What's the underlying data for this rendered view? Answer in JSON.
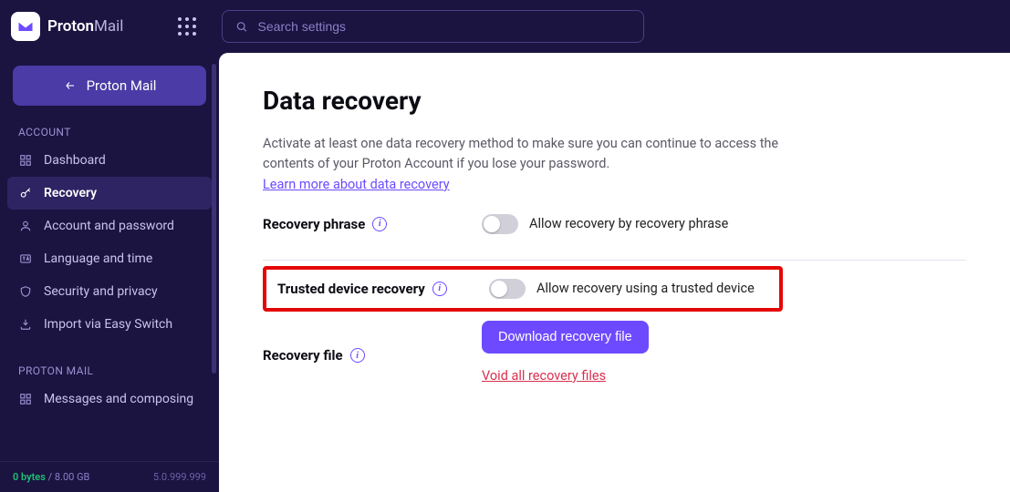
{
  "brand": {
    "name": "Proton",
    "suffix": "Mail"
  },
  "search": {
    "placeholder": "Search settings"
  },
  "back_button": {
    "label": "Proton Mail"
  },
  "sidebar": {
    "sections": [
      {
        "label": "ACCOUNT",
        "items": [
          {
            "label": "Dashboard"
          },
          {
            "label": "Recovery"
          },
          {
            "label": "Account and password"
          },
          {
            "label": "Language and time"
          },
          {
            "label": "Security and privacy"
          },
          {
            "label": "Import via Easy Switch"
          }
        ]
      },
      {
        "label": "PROTON MAIL",
        "items": [
          {
            "label": "Messages and composing"
          }
        ]
      }
    ]
  },
  "footer": {
    "used": "0 bytes",
    "sep": " / ",
    "total": "8.00 GB",
    "version": "5.0.999.999"
  },
  "page": {
    "title": "Data recovery",
    "description": "Activate at least one data recovery method to make sure you can continue to access the contents of your Proton Account if you lose your password.",
    "learn_more": "Learn more about data recovery",
    "rows": {
      "phrase": {
        "label": "Recovery phrase",
        "toggle_label": "Allow recovery by recovery phrase"
      },
      "trusted": {
        "label": "Trusted device recovery",
        "toggle_label": "Allow recovery using a trusted device"
      },
      "file": {
        "label": "Recovery file",
        "button": "Download recovery file",
        "void": "Void all recovery files"
      }
    }
  }
}
